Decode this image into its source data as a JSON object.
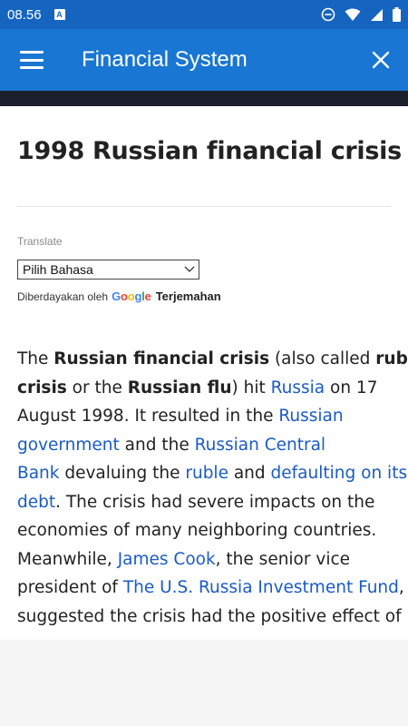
{
  "status_bar": {
    "time": "08.56",
    "badge": "A"
  },
  "app_bar": {
    "title": "Financial System"
  },
  "page": {
    "title": "1998 Russian financial crisis",
    "translate_label": "Translate",
    "language_select_value": "Pilih Bahasa",
    "powered_by_text": "Diberdayakan oleh",
    "google_logo_text": "Google",
    "translate_brand": "Terjemahan"
  },
  "article": {
    "segments": {
      "s1": "The ",
      "s2": "Russian financial crisis",
      "s3": " (also called ",
      "s4": "ruble",
      "s5": "crisis",
      "s6": " or the ",
      "s7": "Russian flu",
      "s8": ") hit ",
      "s9": "Russia",
      "s10": " on 17",
      "s11": "August 1998. It resulted in the ",
      "s12": "Russian",
      "s13": "government",
      "s14": " and the ",
      "s15": "Russian Central",
      "s16": "Bank",
      "s17": " devaluing the ",
      "s18": "ruble",
      "s19": " and ",
      "s20": "defaulting on its",
      "s21": "debt",
      "s22": ". The crisis had severe impacts on the",
      "s23": "economies of many neighboring countries.",
      "s24": "Meanwhile, ",
      "s25": "James Cook",
      "s26": ", the senior vice",
      "s27": "president of ",
      "s28": "The U.S. Russia Investment Fund",
      "s29": ",",
      "s30": "suggested the crisis had the positive effect of"
    }
  },
  "colors": {
    "status_bar": "#1565c0",
    "app_bar": "#1976d2",
    "link": "#1a5bc4"
  }
}
